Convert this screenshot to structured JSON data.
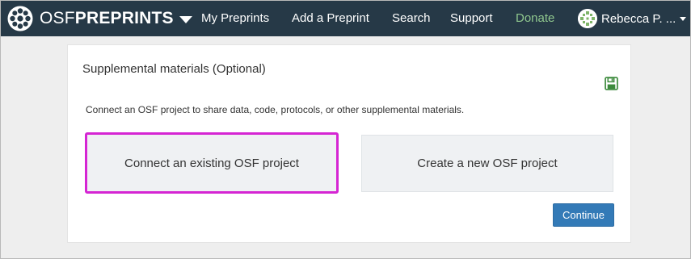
{
  "navbar": {
    "brand_prefix": "OSF",
    "brand_suffix": "PREPRINTS",
    "items": [
      {
        "label": "My Preprints"
      },
      {
        "label": "Add a Preprint"
      },
      {
        "label": "Search"
      },
      {
        "label": "Support"
      },
      {
        "label": "Donate"
      }
    ],
    "user_name": "Rebecca P. ..."
  },
  "panel": {
    "title": "Supplemental materials (Optional)",
    "description": "Connect an OSF project to share data, code, protocols, or other supplemental materials.",
    "option_existing": "Connect an existing OSF project",
    "option_new": "Create a new OSF project",
    "continue_label": "Continue"
  },
  "colors": {
    "navbar_bg": "#263947",
    "donate": "#8fc78e",
    "highlight": "#d525d3",
    "primary": "#337ab7",
    "save_icon": "#3c8a3c"
  }
}
